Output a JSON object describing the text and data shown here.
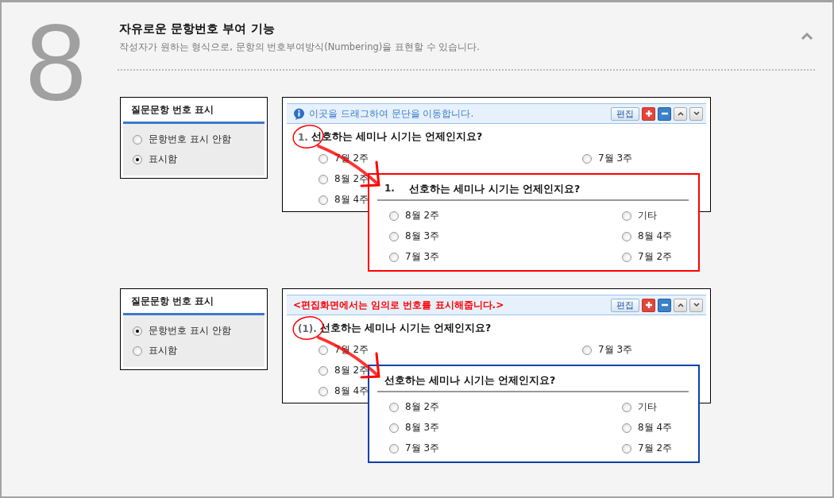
{
  "header": {
    "number": "8",
    "title": "자유로운 문항번호 부여 기능",
    "subtitle": "작성자가 원하는 형식으로, 문항의 번호부여방식(Numbering)을 표현할 수 있습니다."
  },
  "examples": [
    {
      "settings": {
        "title": "질문문항 번호 표시",
        "options": [
          {
            "label": "문항번호 표시 안함",
            "selected": false
          },
          {
            "label": "표시함",
            "selected": true
          }
        ]
      },
      "editor": {
        "banner": {
          "kind": "info",
          "text": "이곳을 드래그하여 문단을 이동합니다."
        },
        "edit_button": "편집",
        "number": "1.",
        "question": "선호하는 세미나 시기는 언제인지요?",
        "options_column_1": [
          {
            "label": "7월 2주",
            "selected": false
          },
          {
            "label": "8월 2주",
            "selected": false
          },
          {
            "label": "8월 4주",
            "selected": false
          }
        ],
        "options_column_2": [
          {
            "label": "7월 3주",
            "selected": false
          }
        ]
      },
      "preview": {
        "color": "#ff0000",
        "number": "1.",
        "question": "선호하는 세미나 시기는 언제인지요?",
        "options": [
          {
            "label": "8월 2주",
            "selected": false
          },
          {
            "label": "기타",
            "selected": false
          },
          {
            "label": "8월 3주",
            "selected": false
          },
          {
            "label": "8월 4주",
            "selected": false
          },
          {
            "label": "7월 3주",
            "selected": false
          },
          {
            "label": "7월 2주",
            "selected": false
          }
        ]
      }
    },
    {
      "settings": {
        "title": "질문문항 번호 표시",
        "options": [
          {
            "label": "문항번호 표시 안함",
            "selected": true
          },
          {
            "label": "표시함",
            "selected": false
          }
        ]
      },
      "editor": {
        "banner": {
          "kind": "notice",
          "text": "<편집화면에서는 임의로 번호를 표시해줍니다.>"
        },
        "edit_button": "편집",
        "number": "(1).",
        "question": "선호하는 세미나 시기는 언제인지요?",
        "options_column_1": [
          {
            "label": "7월 2주",
            "selected": false
          },
          {
            "label": "8월 2주",
            "selected": false
          },
          {
            "label": "8월 4주",
            "selected": false
          }
        ],
        "options_column_2": [
          {
            "label": "7월 3주",
            "selected": false
          }
        ]
      },
      "preview": {
        "color": "#0d3fa8",
        "question": "선호하는 세미나 시기는 언제인지요?",
        "options": [
          {
            "label": "8월 2주",
            "selected": false
          },
          {
            "label": "기타",
            "selected": false
          },
          {
            "label": "8월 3주",
            "selected": false
          },
          {
            "label": "8월 4주",
            "selected": false
          },
          {
            "label": "7월 3주",
            "selected": false
          },
          {
            "label": "7월 2주",
            "selected": false
          }
        ]
      }
    }
  ]
}
